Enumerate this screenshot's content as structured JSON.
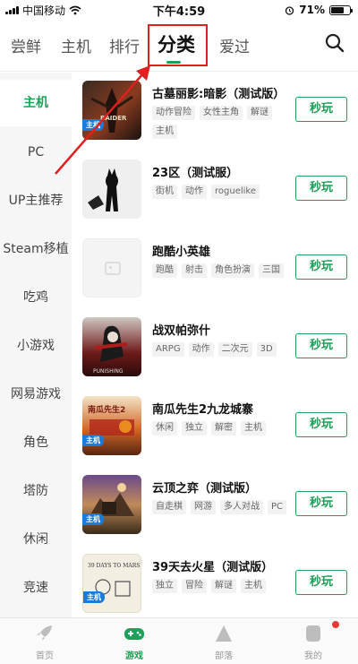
{
  "status_bar": {
    "carrier": "中国移动",
    "time": "下午4:59",
    "battery": "71%",
    "battery_level": 0.71
  },
  "top_tabs": [
    {
      "label": "尝鲜"
    },
    {
      "label": "主机"
    },
    {
      "label": "排行"
    },
    {
      "label": "分类",
      "active": true
    },
    {
      "label": "爱过"
    }
  ],
  "sidebar": [
    {
      "label": "主机",
      "active": true
    },
    {
      "label": "PC"
    },
    {
      "label": "UP主推荐"
    },
    {
      "label": "Steam移植"
    },
    {
      "label": "吃鸡"
    },
    {
      "label": "小游戏"
    },
    {
      "label": "网易游戏"
    },
    {
      "label": "角色"
    },
    {
      "label": "塔防"
    },
    {
      "label": "休闲"
    },
    {
      "label": "竞速"
    }
  ],
  "play_label": "秒玩",
  "host_badge": "主机",
  "games": [
    {
      "title": "古墓丽影:暗影（测试版）",
      "tags": [
        "动作冒险",
        "女性主角",
        "解谜",
        "主机"
      ],
      "thumb_text": "RAIDER",
      "has_badge": true
    },
    {
      "title": "23区（测试服）",
      "tags": [
        "街机",
        "动作",
        "roguelike"
      ],
      "thumb_text": "",
      "has_badge": false
    },
    {
      "title": "跑酷小英雄",
      "tags": [
        "跑酷",
        "射击",
        "角色扮演",
        "三国"
      ],
      "thumb_text": "",
      "has_badge": false
    },
    {
      "title": "战双帕弥什",
      "tags": [
        "ARPG",
        "动作",
        "二次元",
        "3D"
      ],
      "thumb_text": "PUNISHING",
      "has_badge": false
    },
    {
      "title": "南瓜先生2九龙城寨",
      "tags": [
        "休闲",
        "独立",
        "解密",
        "主机"
      ],
      "thumb_text": "南瓜先生2",
      "has_badge": true
    },
    {
      "title": "云顶之弈（测试版）",
      "tags": [
        "自走棋",
        "网游",
        "多人对战",
        "PC"
      ],
      "thumb_text": "",
      "has_badge": true
    },
    {
      "title": "39天去火星（测试版）",
      "tags": [
        "独立",
        "冒险",
        "解谜",
        "主机"
      ],
      "thumb_text": "39 DAYS TO MARS",
      "has_badge": true
    }
  ],
  "bottom_nav": [
    {
      "label": "首页",
      "icon": "rocket-icon"
    },
    {
      "label": "游戏",
      "icon": "gamepad-icon",
      "active": true
    },
    {
      "label": "部落",
      "icon": "mountain-icon"
    },
    {
      "label": "我的",
      "icon": "user-icon",
      "has_dot": true
    }
  ],
  "colors": {
    "accent": "#1da057",
    "annotation": "#e02020",
    "host_badge": "#1a7cd8"
  }
}
